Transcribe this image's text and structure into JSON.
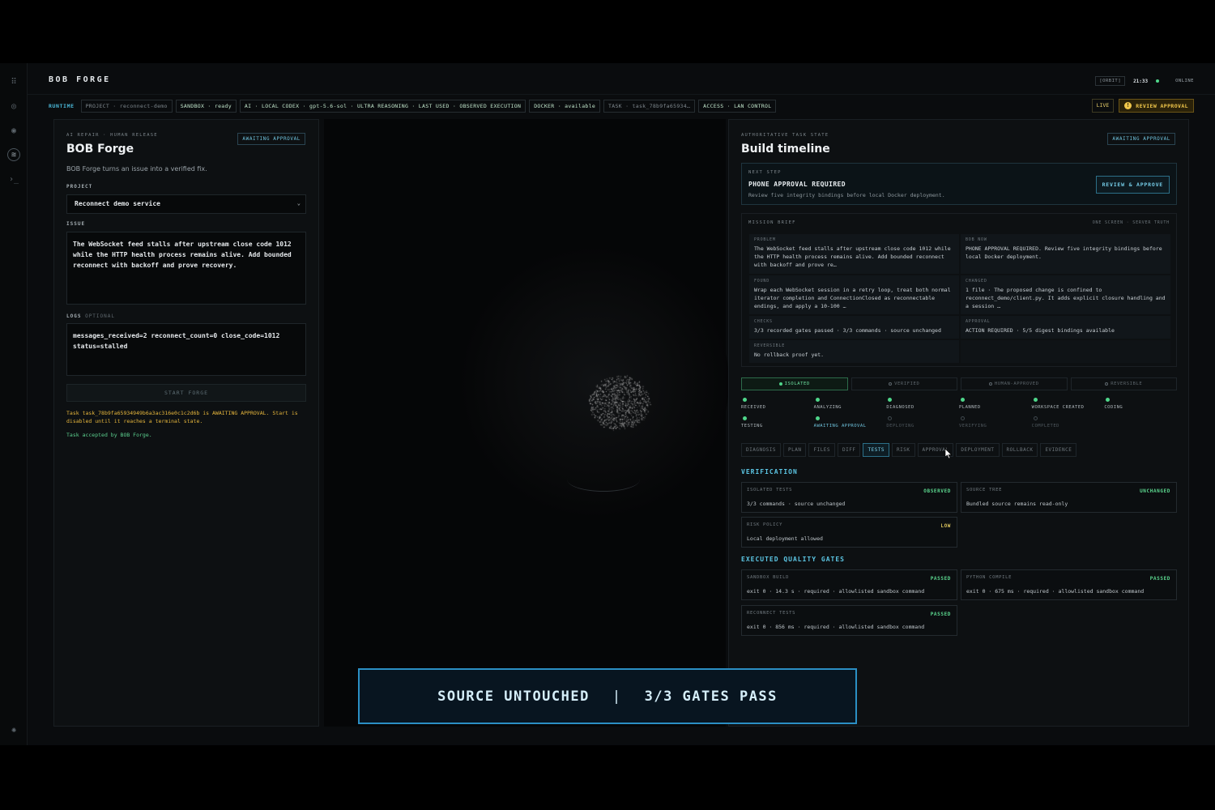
{
  "header": {
    "brand": "BOB FORGE",
    "orbit_badge": "[ORBIT]",
    "clock": "21:33",
    "status": "ONLINE"
  },
  "runtime": {
    "label": "RUNTIME",
    "chips": [
      {
        "text": "PROJECT · reconnect-demo",
        "dim": true
      },
      {
        "text": "SANDBOX · ready",
        "dim": false
      },
      {
        "text": "AI · LOCAL CODEX · gpt-5.6-sol · ULTRA REASONING · LAST USED · OBSERVED EXECUTION",
        "dim": false
      },
      {
        "text": "DOCKER · available",
        "dim": false
      },
      {
        "text": "TASK · task_78b9fa65934…",
        "dim": true
      },
      {
        "text": "ACCESS · LAN CONTROL",
        "dim": false
      }
    ],
    "live_label": "LIVE",
    "review_label": "REVIEW APPROVAL"
  },
  "left_panel": {
    "eyebrow": "AI REPAIR · HUMAN RELEASE",
    "badge": "AWAITING APPROVAL",
    "title": "BOB Forge",
    "subtitle": "BOB Forge turns an issue into a verified fix.",
    "project_label": "PROJECT",
    "project_value": "Reconnect demo service",
    "issue_label": "ISSUE",
    "issue_text": "The WebSocket feed stalls after upstream close code 1012 while the HTTP health process remains alive. Add bounded reconnect with backoff and prove recovery.",
    "logs_label": "LOGS",
    "logs_optional": "OPTIONAL",
    "logs_text": "messages_received=2 reconnect_count=0 close_code=1012 status=stalled",
    "start_button": "START FORGE",
    "task_warning": "Task task_78b9fa65934949b6a3ac316e0c1c2d6b is AWAITING APPROVAL. Start is disabled until it reaches a terminal state.",
    "task_accepted": "Task accepted by BOB Forge."
  },
  "right_panel": {
    "eyebrow": "AUTHORITATIVE TASK STATE",
    "badge": "AWAITING APPROVAL",
    "title": "Build timeline",
    "next_step": {
      "eyebrow": "NEXT STEP",
      "title": "PHONE APPROVAL REQUIRED",
      "desc": "Review five integrity bindings before local Docker deployment.",
      "button": "REVIEW & APPROVE"
    },
    "mission": {
      "eyebrow": "MISSION BRIEF",
      "right_label": "ONE SCREEN · SERVER TRUTH",
      "cells": [
        {
          "label": "PROBLEM",
          "text": "The WebSocket feed stalls after upstream close code 1012 while the HTTP health process remains alive. Add bounded reconnect with backoff and prove re…"
        },
        {
          "label": "BOB NOW",
          "text": "PHONE APPROVAL REQUIRED. Review five integrity bindings before local Docker deployment."
        },
        {
          "label": "FOUND",
          "text": "Wrap each WebSocket session in a retry loop, treat both normal iterator completion and ConnectionClosed as reconnectable endings, and apply a 10-100 …"
        },
        {
          "label": "CHANGED",
          "text": "1 file · The proposed change is confined to reconnect_demo/client.py. It adds explicit closure handling and a session …"
        },
        {
          "label": "CHECKS",
          "text": "3/3 recorded gates passed · 3/3 commands · source unchanged"
        },
        {
          "label": "APPROVAL",
          "text": "ACTION REQUIRED · 5/5 digest bindings available"
        },
        {
          "label": "REVERSIBLE",
          "text": "No rollback proof yet."
        }
      ]
    },
    "stages": [
      {
        "label": "ISOLATED",
        "on": true
      },
      {
        "label": "VERIFIED",
        "on": false
      },
      {
        "label": "HUMAN-APPROVED",
        "on": false
      },
      {
        "label": "REVERSIBLE",
        "on": false
      }
    ],
    "progress": [
      {
        "label": "RECEIVED",
        "state": "done"
      },
      {
        "label": "ANALYZING",
        "state": "done"
      },
      {
        "label": "DIAGNOSED",
        "state": "done"
      },
      {
        "label": "PLANNED",
        "state": "done"
      },
      {
        "label": "WORKSPACE CREATED",
        "state": "done"
      },
      {
        "label": "CODING",
        "state": "done"
      },
      {
        "label": "TESTING",
        "state": "done"
      },
      {
        "label": "AWAITING APPROVAL",
        "state": "current"
      },
      {
        "label": "DEPLOYING",
        "state": "pending"
      },
      {
        "label": "VERIFYING",
        "state": "pending"
      },
      {
        "label": "COMPLETED",
        "state": "pending"
      }
    ],
    "tabs": [
      {
        "label": "DIAGNOSIS",
        "active": false
      },
      {
        "label": "PLAN",
        "active": false
      },
      {
        "label": "FILES",
        "active": false
      },
      {
        "label": "DIFF",
        "active": false
      },
      {
        "label": "TESTS",
        "active": true
      },
      {
        "label": "RISK",
        "active": false
      },
      {
        "label": "APPROVAL",
        "active": false
      },
      {
        "label": "DEPLOYMENT",
        "active": false
      },
      {
        "label": "ROLLBACK",
        "active": false
      },
      {
        "label": "EVIDENCE",
        "active": false
      }
    ],
    "verification_title": "VERIFICATION",
    "verification": [
      {
        "label": "ISOLATED TESTS",
        "status": "OBSERVED",
        "text": "3/3 commands · source unchanged"
      },
      {
        "label": "SOURCE TREE",
        "status": "UNCHANGED",
        "text": "Bundled source remains read-only"
      },
      {
        "label": "RISK POLICY",
        "status": "LOW",
        "text": "Local deployment allowed"
      }
    ],
    "gates_title": "EXECUTED QUALITY GATES",
    "gates": [
      {
        "label": "SANDBOX BUILD",
        "status": "PASSED",
        "text": "exit 0 · 14.3 s · required · allowlisted sandbox command"
      },
      {
        "label": "PYTHON COMPILE",
        "status": "PASSED",
        "text": "exit 0 · 675 ms · required · allowlisted sandbox command"
      },
      {
        "label": "RECONNECT TESTS",
        "status": "PASSED",
        "text": "exit 0 · 856 ms · required · allowlisted sandbox command"
      }
    ]
  },
  "banner": {
    "left": "SOURCE UNTOUCHED",
    "separator": "|",
    "right": "3/3 GATES PASS"
  },
  "colors": {
    "accent": "#4ab6d6",
    "success": "#4fd68a",
    "warning": "#f0c64a",
    "banner_border": "#2b8fc4"
  }
}
